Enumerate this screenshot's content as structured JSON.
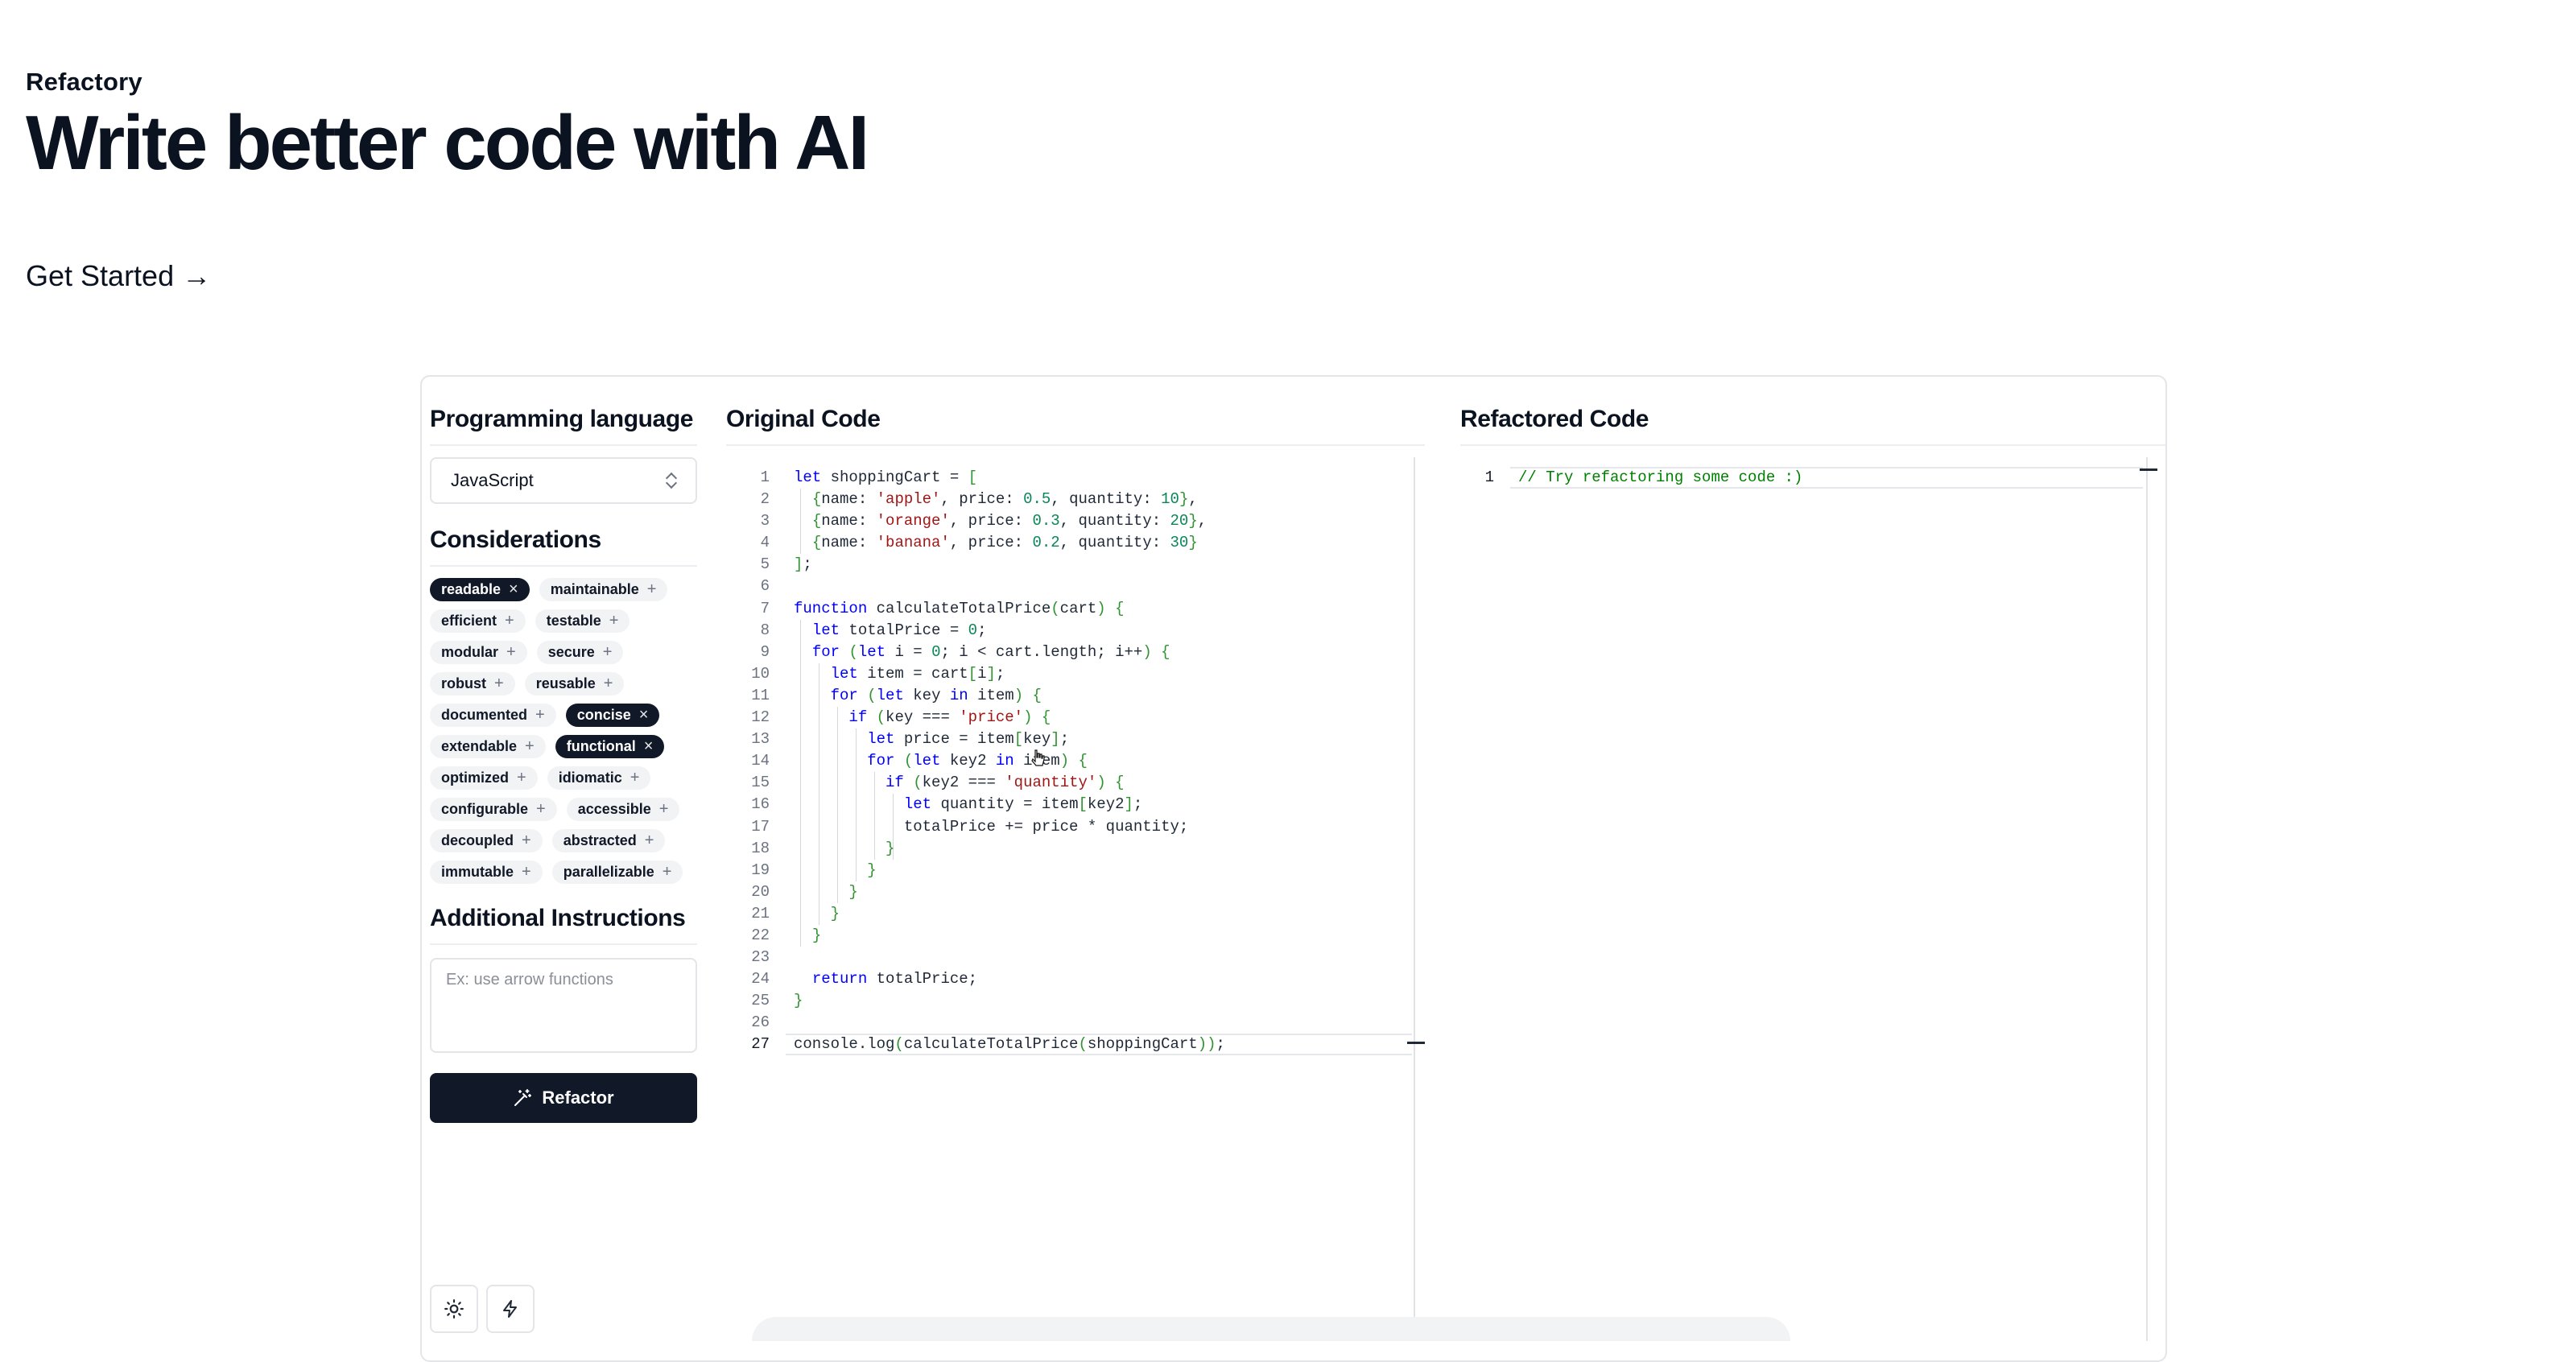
{
  "hero": {
    "brand": "Refactory",
    "headline": "Write better code with AI",
    "cta_label": "Get Started →"
  },
  "app": {
    "language_section_title": "Programming language",
    "language_selected": "JavaScript",
    "considerations_title": "Considerations",
    "considerations": [
      {
        "label": "readable",
        "selected": true
      },
      {
        "label": "maintainable",
        "selected": false
      },
      {
        "label": "efficient",
        "selected": false
      },
      {
        "label": "testable",
        "selected": false
      },
      {
        "label": "modular",
        "selected": false
      },
      {
        "label": "secure",
        "selected": false
      },
      {
        "label": "robust",
        "selected": false
      },
      {
        "label": "reusable",
        "selected": false
      },
      {
        "label": "documented",
        "selected": false
      },
      {
        "label": "concise",
        "selected": true
      },
      {
        "label": "extendable",
        "selected": false
      },
      {
        "label": "functional",
        "selected": true
      },
      {
        "label": "optimized",
        "selected": false
      },
      {
        "label": "idiomatic",
        "selected": false
      },
      {
        "label": "configurable",
        "selected": false
      },
      {
        "label": "accessible",
        "selected": false
      },
      {
        "label": "decoupled",
        "selected": false
      },
      {
        "label": "abstracted",
        "selected": false
      },
      {
        "label": "immutable",
        "selected": false
      },
      {
        "label": "parallelizable",
        "selected": false
      }
    ],
    "additional_title": "Additional Instructions",
    "instructions_placeholder": "Ex: use arrow functions",
    "instructions_value": "",
    "refactor_label": "Refactor",
    "original_title": "Original Code",
    "refactored_title": "Refactored Code",
    "original_code": [
      "let shoppingCart = [",
      "  {name: 'apple', price: 0.5, quantity: 10},",
      "  {name: 'orange', price: 0.3, quantity: 20},",
      "  {name: 'banana', price: 0.2, quantity: 30}",
      "];",
      "",
      "function calculateTotalPrice(cart) {",
      "  let totalPrice = 0;",
      "  for (let i = 0; i < cart.length; i++) {",
      "    let item = cart[i];",
      "    for (let key in item) {",
      "      if (key === 'price') {",
      "        let price = item[key];",
      "        for (let key2 in item) {",
      "          if (key2 === 'quantity') {",
      "            let quantity = item[key2];",
      "            totalPrice += price * quantity;",
      "          }",
      "        }",
      "      }",
      "    }",
      "  }",
      "",
      "  return totalPrice;",
      "}",
      "",
      "console.log(calculateTotalPrice(shoppingCart));"
    ],
    "refactored_code": [
      "// Try refactoring some code :)"
    ],
    "icons": {
      "theme": "sun-icon",
      "action": "lightning-icon",
      "refactor": "magic-wand-icon"
    }
  }
}
